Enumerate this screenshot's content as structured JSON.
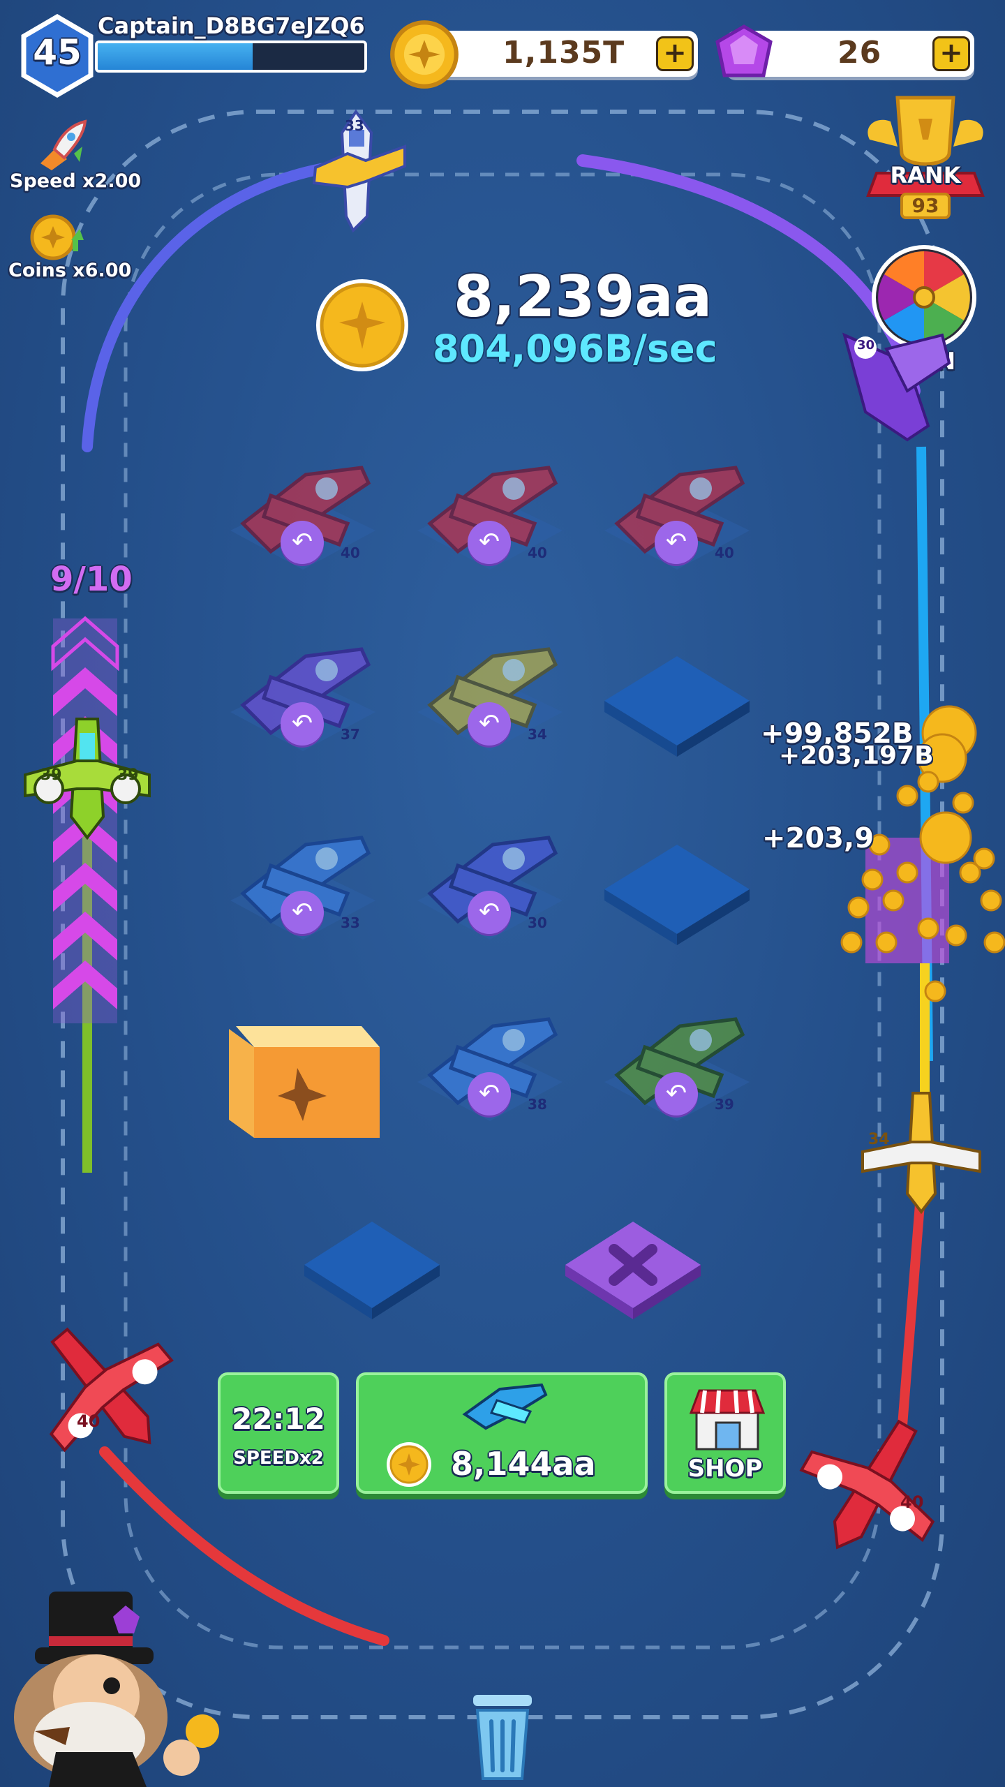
{
  "player": {
    "level": "45",
    "name": "Captain_D8BG7eJZQ6",
    "xp_fraction": 0.58
  },
  "resources": {
    "coins": "1,135T",
    "gems": "26"
  },
  "buffs": [
    {
      "label": "Speed x2.00",
      "icon": "rocket-icon"
    },
    {
      "label": "Coins x6.00",
      "icon": "coin-boost-icon"
    }
  ],
  "rank": {
    "label": "RANK",
    "value": "93"
  },
  "spin": {
    "label": "SPIN"
  },
  "earnings": {
    "total": "8,239aa",
    "rate": "804,096B/sec"
  },
  "runway": {
    "counter": "9/10"
  },
  "popups": [
    "+99,852B",
    "+203,197B",
    "+203,9"
  ],
  "grid": {
    "cells": [
      {
        "plane": "red-plane",
        "level": "40",
        "undo": true
      },
      {
        "plane": "red-plane",
        "level": "40",
        "undo": true
      },
      {
        "plane": "red-plane",
        "level": "40",
        "undo": true
      },
      {
        "plane": "purple-plane",
        "level": "37",
        "undo": true
      },
      {
        "plane": "olive-plane",
        "level": "34",
        "undo": true
      },
      {
        "plane": "empty",
        "level": "",
        "undo": false
      },
      {
        "plane": "blue-plane",
        "level": "33",
        "undo": true
      },
      {
        "plane": "navy-plane",
        "level": "30",
        "undo": true
      },
      {
        "plane": "empty",
        "level": "",
        "undo": false
      },
      {
        "plane": "mystery-box",
        "level": "",
        "undo": false
      },
      {
        "plane": "blue-plane",
        "level": "38",
        "undo": true
      },
      {
        "plane": "green-plane",
        "level": "39",
        "undo": true
      }
    ]
  },
  "track_planes": [
    {
      "name": "plane-33",
      "level": "33"
    },
    {
      "name": "plane-30",
      "level": "30"
    },
    {
      "name": "plane-39",
      "level": "39"
    },
    {
      "name": "plane-34",
      "level": "34"
    },
    {
      "name": "plane-40-left",
      "level": "40"
    },
    {
      "name": "plane-40-right",
      "level": "40"
    }
  ],
  "buttons": {
    "speed_timer": "22:12",
    "speed_label": "SPEEDx2",
    "buy_price": "8,144aa",
    "shop_label": "SHOP"
  },
  "colors": {
    "accent_green": "#4ed05a",
    "accent_purple": "#9c67ea",
    "coin_gold": "#f5b81d",
    "rate_cyan": "#5ee8ff"
  }
}
